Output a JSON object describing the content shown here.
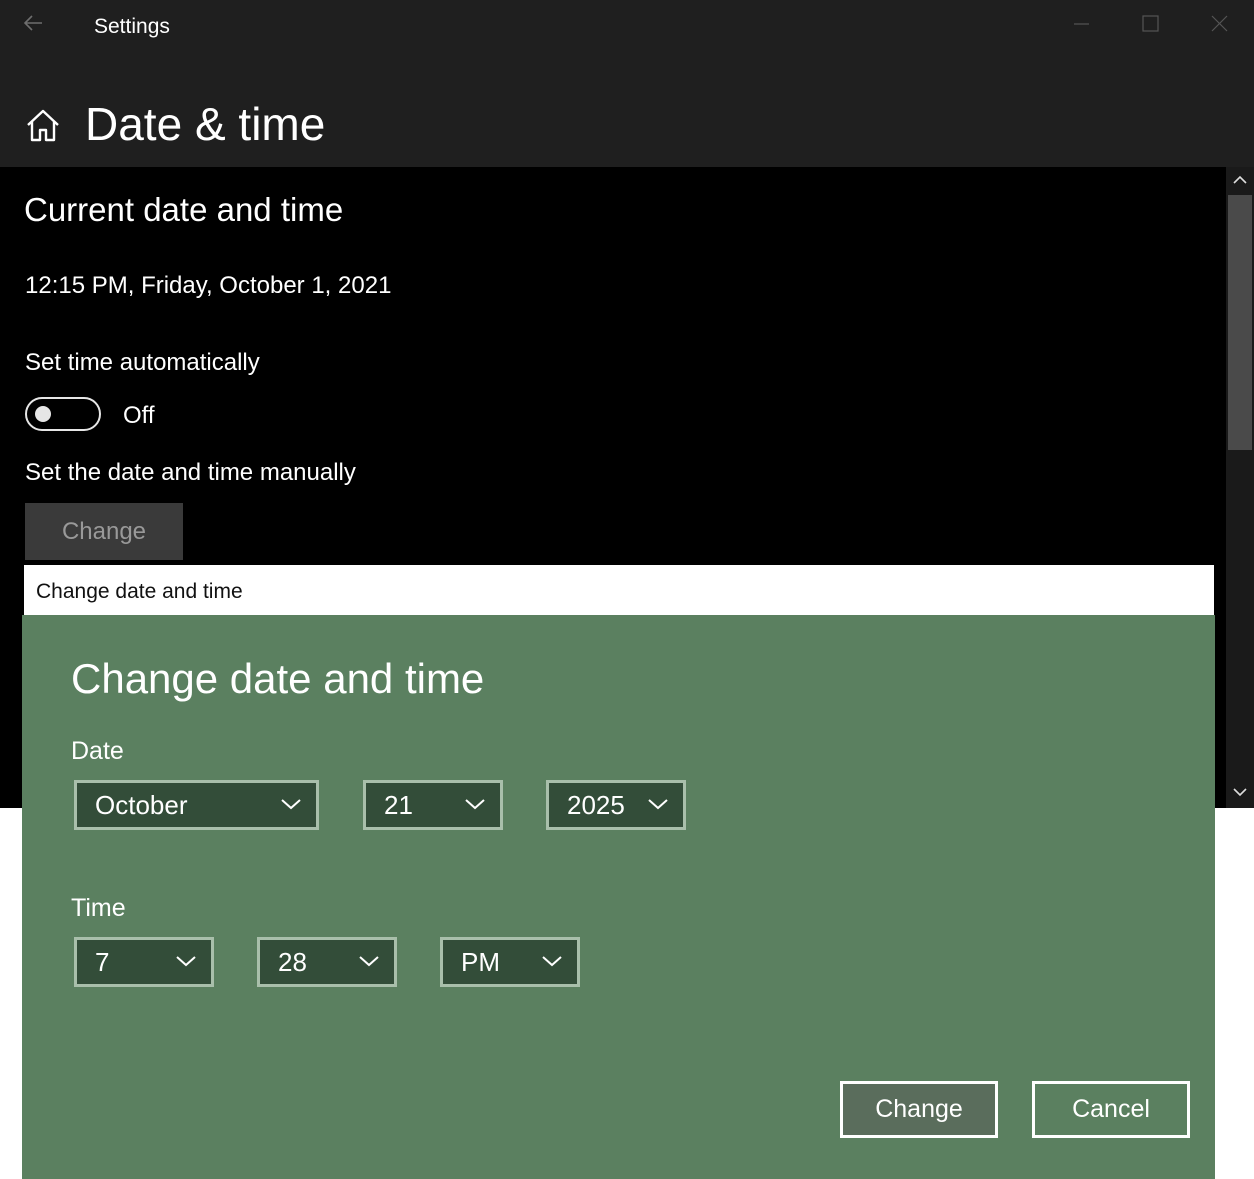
{
  "window": {
    "app_title": "Settings",
    "page_title": "Date & time",
    "icons": [
      "back-arrow-icon",
      "home-icon",
      "minimize-icon",
      "maximize-icon",
      "close-icon"
    ]
  },
  "content": {
    "section_title": "Current date and time",
    "current_datetime": "12:15 PM, Friday, October 1, 2021",
    "auto_time_label": "Set time automatically",
    "auto_time_state": "Off",
    "auto_time_on": false,
    "manual_label": "Set the date and time manually",
    "manual_button": "Change"
  },
  "dialog": {
    "window_title": "Change date and time",
    "heading": "Change date and time",
    "date_label": "Date",
    "month": "October",
    "day": "21",
    "year": "2025",
    "time_label": "Time",
    "hour": "7",
    "minute": "28",
    "ampm": "PM",
    "primary_button": "Change",
    "secondary_button": "Cancel"
  },
  "colors": {
    "dialog_bg": "#5b8060",
    "select_bg": "#334d39",
    "window_bg": "#000000",
    "titlebar_bg": "#1f1f1f"
  }
}
